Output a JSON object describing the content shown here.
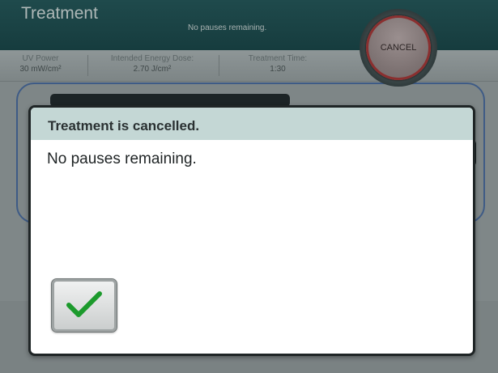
{
  "header": {
    "title": "Treatment",
    "status": "No pauses remaining."
  },
  "info": {
    "uv_power_label": "UV Power",
    "uv_power_value": "30 mW/cm²",
    "energy_dose_label": "Intended Energy Dose:",
    "energy_dose_value": "2.70 J/cm²",
    "treatment_time_label": "Treatment Time:",
    "treatment_time_value": "1:30"
  },
  "cancel_button": {
    "label": "CANCEL"
  },
  "dialog": {
    "title": "Treatment is cancelled.",
    "message": "No pauses remaining.",
    "confirm_icon": "checkmark-icon"
  },
  "colors": {
    "header_bg": "#1f4a4c",
    "dialog_header_bg": "#c4d7d5",
    "check_green": "#1c9a2c",
    "panel_border": "#3e5b86"
  }
}
